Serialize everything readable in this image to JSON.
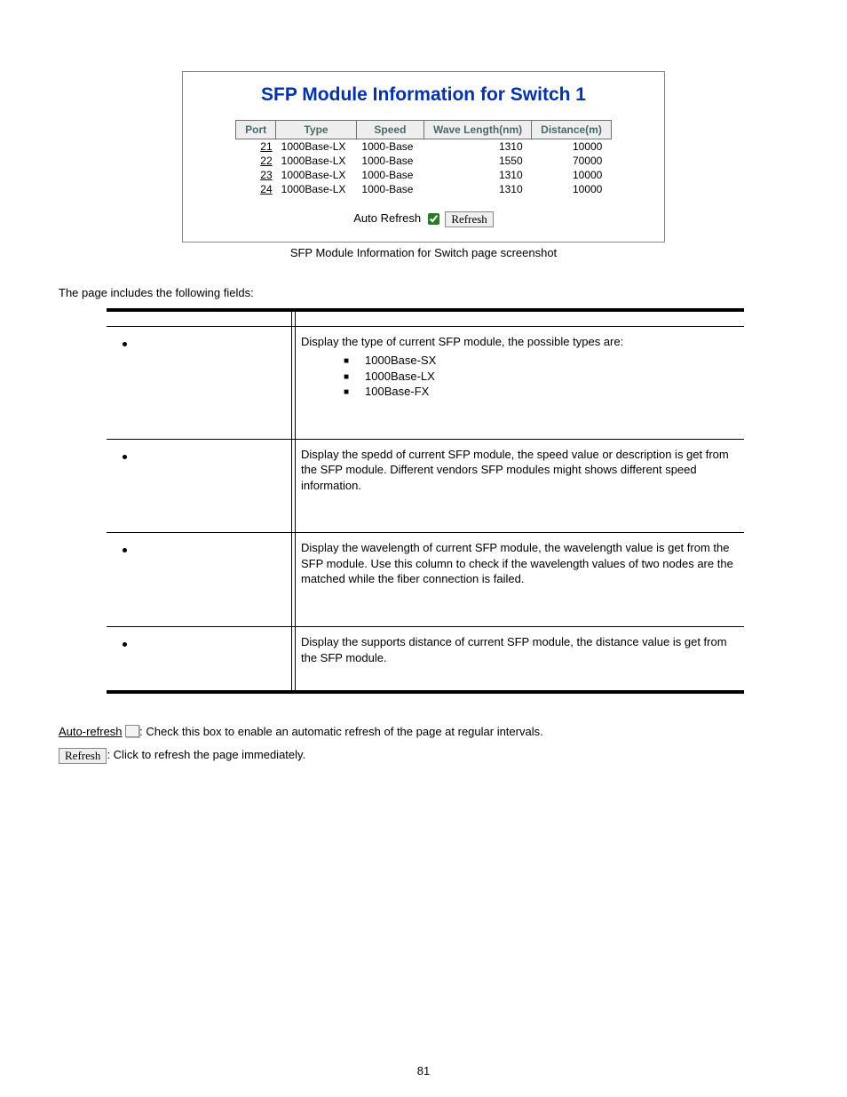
{
  "screenshot": {
    "title": "SFP Module Information for Switch 1",
    "headers": {
      "port": "Port",
      "type": "Type",
      "speed": "Speed",
      "wave": "Wave Length(nm)",
      "dist": "Distance(m)"
    },
    "rows": [
      {
        "port": "21",
        "type": "1000Base-LX",
        "speed": "1000-Base",
        "wave": "1310",
        "dist": "10000"
      },
      {
        "port": "22",
        "type": "1000Base-LX",
        "speed": "1000-Base",
        "wave": "1550",
        "dist": "70000"
      },
      {
        "port": "23",
        "type": "1000Base-LX",
        "speed": "1000-Base",
        "wave": "1310",
        "dist": "10000"
      },
      {
        "port": "24",
        "type": "1000Base-LX",
        "speed": "1000-Base",
        "wave": "1310",
        "dist": "10000"
      }
    ],
    "auto_refresh_label": "Auto Refresh",
    "refresh_button": "Refresh"
  },
  "caption": "SFP Module Information for Switch page screenshot",
  "intro": "The page includes the following fields:",
  "fields": [
    {
      "desc_pre": "Display the type of current SFP module, the possible types are:",
      "subitems": [
        "1000Base-SX",
        "1000Base-LX",
        "100Base-FX"
      ]
    },
    {
      "desc": "Display the spedd of current SFP module, the speed value or description is get from the SFP module. Different vendors SFP modules might shows different speed information."
    },
    {
      "desc": "Display the wavelength of current SFP module, the wavelength value is get from the SFP module. Use this column to check if the wavelength values of two nodes are the matched while the fiber connection is failed."
    },
    {
      "desc": "Display the supports distance of current SFP module, the distance value is get from the SFP module."
    }
  ],
  "notes": {
    "auto_label": "Auto-refresh",
    "auto_desc": ": Check this box to enable an automatic refresh of the page at regular intervals.",
    "refresh_btn": "Refresh",
    "refresh_desc": ": Click to refresh the page immediately."
  },
  "page_number": "81"
}
